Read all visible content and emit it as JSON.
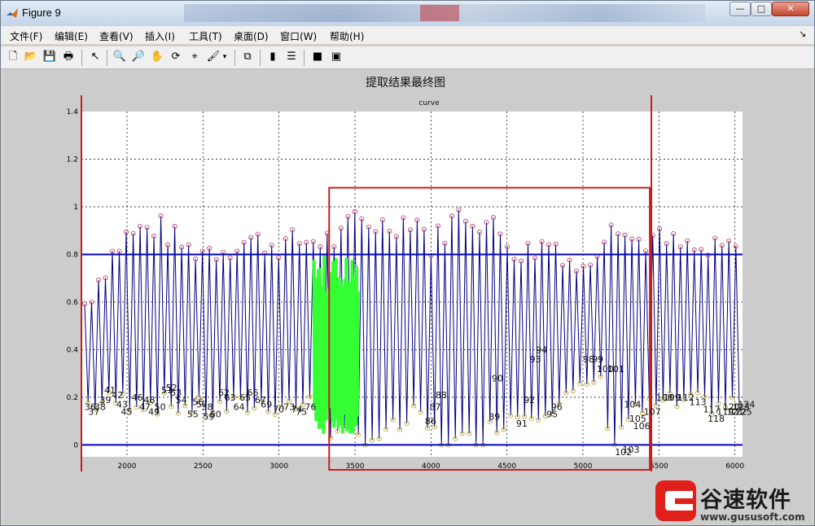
{
  "window": {
    "title": "Figure 9",
    "buttons": {
      "minimize": "—",
      "maximize": "□",
      "close": "✕"
    }
  },
  "menu": [
    {
      "label": "文件(F)"
    },
    {
      "label": "编辑(E)"
    },
    {
      "label": "查看(V)"
    },
    {
      "label": "插入(I)"
    },
    {
      "label": "工具(T)"
    },
    {
      "label": "桌面(D)"
    },
    {
      "label": "窗口(W)"
    },
    {
      "label": "帮助(H)"
    }
  ],
  "menu_overflow_icon": "arrow-icon",
  "toolbar": [
    {
      "icon": "new-figure-icon",
      "glyph": "🗋"
    },
    {
      "icon": "open-file-icon",
      "glyph": "📂"
    },
    {
      "icon": "save-icon",
      "glyph": "💾"
    },
    {
      "icon": "print-icon",
      "glyph": "🖶"
    },
    {
      "icon": "edit-plot-arrow-icon",
      "glyph": "↖"
    },
    {
      "icon": "zoom-in-icon",
      "glyph": "🔍"
    },
    {
      "icon": "zoom-out-icon",
      "glyph": "🔎"
    },
    {
      "icon": "pan-hand-icon",
      "glyph": "✋"
    },
    {
      "icon": "rotate-3d-icon",
      "glyph": "⟳"
    },
    {
      "icon": "data-cursor-icon",
      "glyph": "⌖"
    },
    {
      "icon": "brush-icon",
      "glyph": "🖌"
    },
    {
      "icon": "link-plot-icon",
      "glyph": "⧉"
    },
    {
      "icon": "colorbar-icon",
      "glyph": "▮"
    },
    {
      "icon": "legend-icon",
      "glyph": "☰"
    },
    {
      "icon": "hide-plot-tools-icon",
      "glyph": "■"
    },
    {
      "icon": "show-plot-tools-icon",
      "glyph": "▣"
    }
  ],
  "figure_title": "提取结果最终图",
  "chart_data": {
    "type": "line",
    "title": "curve",
    "xlabel": "",
    "ylabel": "",
    "xlim": [
      1700,
      6050
    ],
    "ylim": [
      -0.05,
      1.4
    ],
    "xticks": [
      2000,
      2500,
      3000,
      3500,
      4000,
      4500,
      5000,
      5500,
      6000
    ],
    "yticks": [
      0,
      0.2,
      0.4,
      0.6,
      0.8,
      1,
      1.2,
      1.4
    ],
    "grid": true,
    "series": [
      {
        "name": "",
        "color": "#000080",
        "x_start": 1710,
        "x_end": 6040,
        "n_cycles": 95,
        "peak_envelope": [
          [
            1710,
            0.58
          ],
          [
            1900,
            0.8
          ],
          [
            2000,
            0.88
          ],
          [
            2200,
            0.92
          ],
          [
            2400,
            0.82
          ],
          [
            2600,
            0.82
          ],
          [
            2800,
            0.86
          ],
          [
            3000,
            0.84
          ],
          [
            3200,
            0.86
          ],
          [
            3400,
            0.86
          ],
          [
            3500,
            0.95
          ],
          [
            3700,
            0.92
          ],
          [
            3900,
            0.96
          ],
          [
            4000,
            0.84
          ],
          [
            4200,
            0.98
          ],
          [
            4400,
            0.92
          ],
          [
            4600,
            0.8
          ],
          [
            4800,
            0.86
          ],
          [
            5000,
            0.72
          ],
          [
            5200,
            0.98
          ],
          [
            5300,
            0.86
          ],
          [
            5500,
            0.86
          ],
          [
            5800,
            0.8
          ],
          [
            6040,
            0.84
          ]
        ],
        "valley_envelope": [
          [
            1710,
            0.17
          ],
          [
            2000,
            0.19
          ],
          [
            2500,
            0.15
          ],
          [
            3000,
            0.17
          ],
          [
            3200,
            0.17
          ],
          [
            3400,
            0.02
          ],
          [
            3700,
            0.04
          ],
          [
            3900,
            0.12
          ],
          [
            4100,
            0.0
          ],
          [
            4300,
            0.02
          ],
          [
            4500,
            0.12
          ],
          [
            4800,
            0.17
          ],
          [
            5000,
            0.22
          ],
          [
            5100,
            0.3
          ],
          [
            5200,
            0.0
          ],
          [
            5300,
            0.12
          ],
          [
            5500,
            0.17
          ],
          [
            6040,
            0.17
          ]
        ]
      },
      {
        "name": "",
        "color": "#33ff33",
        "x_start": 3230,
        "x_end": 3520
      }
    ],
    "horizontal_lines": [
      {
        "y": 0.8,
        "color": "#0000c8"
      },
      {
        "y": 0,
        "color": "#0000c8"
      }
    ],
    "vertical_lines": [
      {
        "x": 1700,
        "color": "#d01818"
      },
      {
        "x": 5450,
        "color": "#d01818"
      }
    ],
    "rectangle": {
      "x0": 3330,
      "x1": 5440,
      "y0": -0.05,
      "y1": 1.08,
      "color": "#c81e1e"
    },
    "marker_labels": [
      "36",
      "37",
      "38",
      "39",
      "41",
      "42",
      "43",
      "45",
      "46",
      "47",
      "48",
      "49",
      "50",
      "51",
      "52",
      "53",
      "54",
      "55",
      "56",
      "57",
      "58",
      "59",
      "60",
      "62",
      "63",
      "64",
      "65",
      "66",
      "67",
      "69",
      "70",
      "73",
      "74",
      "75",
      "76",
      "86",
      "87",
      "88",
      "89",
      "90",
      "91",
      "92",
      "93",
      "94",
      "95",
      "96",
      "98",
      "99",
      "100",
      "101",
      "102",
      "103",
      "104",
      "105",
      "106",
      "107",
      "108",
      "109",
      "112",
      "113",
      "117",
      "118",
      "119",
      "120",
      "121",
      "122",
      "123",
      "124",
      "125"
    ],
    "visible_label_samples": [
      {
        "text": "36",
        "x": 1720,
        "y": 0.16
      },
      {
        "text": "37",
        "x": 1745,
        "y": 0.14
      },
      {
        "text": "38",
        "x": 1785,
        "y": 0.16
      },
      {
        "text": "39",
        "x": 1820,
        "y": 0.19
      },
      {
        "text": "41",
        "x": 1850,
        "y": 0.23
      },
      {
        "text": "42",
        "x": 1900,
        "y": 0.21
      },
      {
        "text": "43",
        "x": 1930,
        "y": 0.17
      },
      {
        "text": "45",
        "x": 1960,
        "y": 0.14
      },
      {
        "text": "46",
        "x": 2030,
        "y": 0.2
      },
      {
        "text": "47",
        "x": 2080,
        "y": 0.16
      },
      {
        "text": "48",
        "x": 2110,
        "y": 0.19
      },
      {
        "text": "49",
        "x": 2140,
        "y": 0.14
      },
      {
        "text": "50",
        "x": 2180,
        "y": 0.16
      },
      {
        "text": "51",
        "x": 2225,
        "y": 0.23
      },
      {
        "text": "52",
        "x": 2255,
        "y": 0.24
      },
      {
        "text": "53",
        "x": 2285,
        "y": 0.22
      },
      {
        "text": "54",
        "x": 2320,
        "y": 0.19
      },
      {
        "text": "55",
        "x": 2395,
        "y": 0.13
      },
      {
        "text": "56",
        "x": 2430,
        "y": 0.18
      },
      {
        "text": "57",
        "x": 2455,
        "y": 0.17
      },
      {
        "text": "58",
        "x": 2490,
        "y": 0.16
      },
      {
        "text": "59",
        "x": 2500,
        "y": 0.12
      },
      {
        "text": "60",
        "x": 2545,
        "y": 0.13
      },
      {
        "text": "62",
        "x": 2600,
        "y": 0.22
      },
      {
        "text": "63",
        "x": 2640,
        "y": 0.2
      },
      {
        "text": "64",
        "x": 2700,
        "y": 0.16
      },
      {
        "text": "65",
        "x": 2740,
        "y": 0.2
      },
      {
        "text": "66",
        "x": 2790,
        "y": 0.22
      },
      {
        "text": "67",
        "x": 2840,
        "y": 0.19
      },
      {
        "text": "69",
        "x": 2880,
        "y": 0.17
      },
      {
        "text": "70",
        "x": 2960,
        "y": 0.15
      },
      {
        "text": "73",
        "x": 3030,
        "y": 0.16
      },
      {
        "text": "74",
        "x": 3080,
        "y": 0.15
      },
      {
        "text": "75",
        "x": 3110,
        "y": 0.14
      },
      {
        "text": "76",
        "x": 3170,
        "y": 0.16
      },
      {
        "text": "86",
        "x": 3960,
        "y": 0.1
      },
      {
        "text": "87",
        "x": 3990,
        "y": 0.16
      },
      {
        "text": "88",
        "x": 4030,
        "y": 0.21
      },
      {
        "text": "89",
        "x": 4380,
        "y": 0.12
      },
      {
        "text": "90",
        "x": 4400,
        "y": 0.28
      },
      {
        "text": "91",
        "x": 4560,
        "y": 0.09
      },
      {
        "text": "92",
        "x": 4610,
        "y": 0.19
      },
      {
        "text": "93",
        "x": 4650,
        "y": 0.36
      },
      {
        "text": "94",
        "x": 4690,
        "y": 0.4
      },
      {
        "text": "95",
        "x": 4760,
        "y": 0.13
      },
      {
        "text": "96",
        "x": 4790,
        "y": 0.16
      },
      {
        "text": "98",
        "x": 5000,
        "y": 0.36
      },
      {
        "text": "99",
        "x": 5060,
        "y": 0.36
      },
      {
        "text": "100",
        "x": 5090,
        "y": 0.32
      },
      {
        "text": "101",
        "x": 5160,
        "y": 0.32
      },
      {
        "text": "102",
        "x": 5210,
        "y": -0.03
      },
      {
        "text": "103",
        "x": 5260,
        "y": -0.02
      },
      {
        "text": "104",
        "x": 5270,
        "y": 0.17
      },
      {
        "text": "105",
        "x": 5305,
        "y": 0.11
      },
      {
        "text": "106",
        "x": 5330,
        "y": 0.08
      },
      {
        "text": "107",
        "x": 5400,
        "y": 0.14
      },
      {
        "text": "108",
        "x": 5480,
        "y": 0.2
      },
      {
        "text": "109",
        "x": 5530,
        "y": 0.2
      },
      {
        "text": "112",
        "x": 5620,
        "y": 0.2
      },
      {
        "text": "113",
        "x": 5700,
        "y": 0.18
      },
      {
        "text": "117",
        "x": 5790,
        "y": 0.15
      },
      {
        "text": "118",
        "x": 5820,
        "y": 0.11
      },
      {
        "text": "119",
        "x": 5880,
        "y": 0.14
      },
      {
        "text": "120",
        "x": 5920,
        "y": 0.16
      },
      {
        "text": "121",
        "x": 5945,
        "y": 0.14
      },
      {
        "text": "122",
        "x": 5965,
        "y": 0.14
      },
      {
        "text": "123",
        "x": 5985,
        "y": 0.16
      },
      {
        "text": "124",
        "x": 6020,
        "y": 0.17
      },
      {
        "text": "125",
        "x": 6000,
        "y": 0.14
      }
    ]
  },
  "watermark": {
    "title": "谷速软件",
    "url": "www.gususoft.com"
  }
}
